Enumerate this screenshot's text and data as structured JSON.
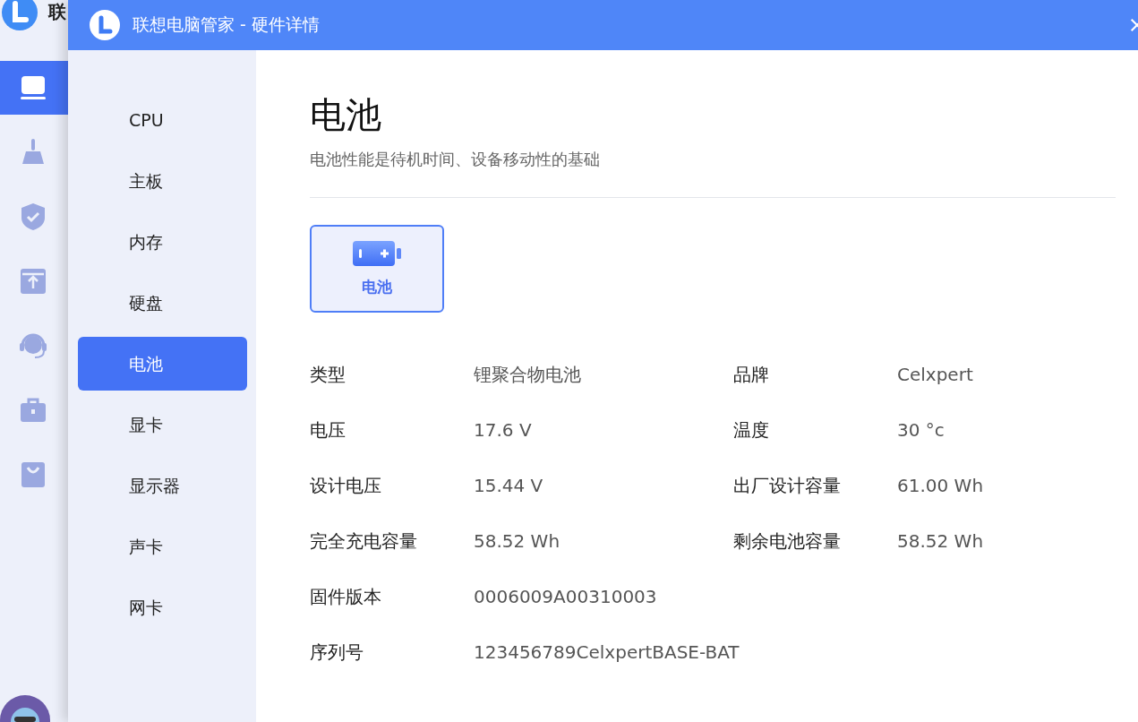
{
  "background_app": {
    "logo_text": "联",
    "nav": [
      {
        "kind": "laptop",
        "selected": true
      },
      {
        "kind": "broom",
        "selected": false
      },
      {
        "kind": "shield",
        "selected": false
      },
      {
        "kind": "upload",
        "selected": false
      },
      {
        "kind": "headset",
        "selected": false
      },
      {
        "kind": "briefcase",
        "selected": false
      },
      {
        "kind": "bag",
        "selected": false
      }
    ]
  },
  "dialog": {
    "title": "联想电脑管家 - 硬件详情",
    "nav": [
      {
        "label": "CPU",
        "selected": false
      },
      {
        "label": "主板",
        "selected": false
      },
      {
        "label": "内存",
        "selected": false
      },
      {
        "label": "硬盘",
        "selected": false
      },
      {
        "label": "电池",
        "selected": true
      },
      {
        "label": "显卡",
        "selected": false
      },
      {
        "label": "显示器",
        "selected": false
      },
      {
        "label": "声卡",
        "selected": false
      },
      {
        "label": "网卡",
        "selected": false
      }
    ],
    "heading": "电池",
    "description": "电池性能是待机时间、设备移动性的基础",
    "devices": [
      {
        "label": "电池",
        "selected": true
      }
    ],
    "specs": [
      [
        {
          "label": "类型",
          "value": "锂聚合物电池"
        },
        {
          "label": "品牌",
          "value": "Celxpert"
        }
      ],
      [
        {
          "label": "电压",
          "value": "17.6 V"
        },
        {
          "label": "温度",
          "value": "30 °c"
        }
      ],
      [
        {
          "label": "设计电压",
          "value": "15.44 V"
        },
        {
          "label": "出厂设计容量",
          "value": "61.00 Wh"
        }
      ],
      [
        {
          "label": "完全充电容量",
          "value": "58.52 Wh"
        },
        {
          "label": "剩余电池容量",
          "value": "58.52 Wh"
        }
      ],
      [
        {
          "label": "固件版本",
          "value": "0006009A00310003"
        }
      ],
      [
        {
          "label": "序列号",
          "value": "123456789CelxpertBASE-BAT"
        }
      ]
    ]
  }
}
